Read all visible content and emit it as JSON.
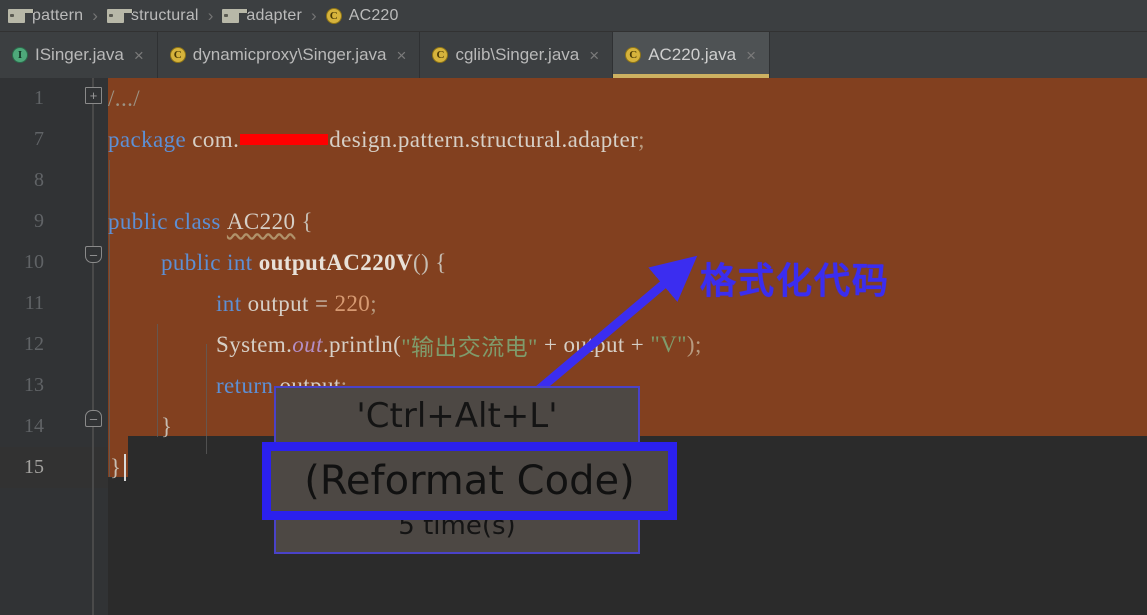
{
  "breadcrumb": {
    "items": [
      {
        "label": "pattern",
        "icon": "folder-icon"
      },
      {
        "label": "structural",
        "icon": "folder-icon"
      },
      {
        "label": "adapter",
        "icon": "folder-icon"
      },
      {
        "label": "AC220",
        "icon": "java-class-icon"
      }
    ],
    "separator": "›"
  },
  "tabs": [
    {
      "label": "ISinger.java",
      "icon": "java-interface-icon",
      "close": "×",
      "active": false
    },
    {
      "label": "dynamicproxy\\Singer.java",
      "icon": "java-class-icon",
      "close": "×",
      "active": false
    },
    {
      "label": "cglib\\Singer.java",
      "icon": "java-class-icon",
      "close": "×",
      "active": false
    },
    {
      "label": "AC220.java",
      "icon": "java-class-icon",
      "close": "×",
      "active": true
    }
  ],
  "editor": {
    "line_numbers": [
      "1",
      "7",
      "8",
      "9",
      "10",
      "11",
      "12",
      "13",
      "14",
      "15"
    ],
    "current_line": "15",
    "fold_markers": {
      "expand": "+",
      "collapse_top": "–",
      "collapse_bottom": "–"
    },
    "lines": {
      "l1_comment": "/.../",
      "l7_package_kw": "package",
      "l7_pkg_a": " com.",
      "l7_pkg_b": "design.pattern.structural.adapter",
      "l7_semi": ";",
      "l9_public": "public",
      "l9_class": "class",
      "l9_name": "AC220",
      "l9_brace": "{",
      "l10_public": "public",
      "l10_int": "int",
      "l10_method": "outputAC220V",
      "l10_parens": "()",
      "l10_brace": "{",
      "l11_int": "int",
      "l11_var": " output = ",
      "l11_num": "220",
      "l11_semi": ";",
      "l12_sysout_a": "System.",
      "l12_out": "out",
      "l12_println": ".println(",
      "l12_str1": "\"输出交流电\"",
      "l12_plus1": " + output + ",
      "l12_str2": "\"V\"",
      "l12_tail": ");",
      "l13_return": "return",
      "l13_var": " output",
      "l13_semi": ";",
      "l14_brace": "}",
      "l15_brace": "}"
    }
  },
  "annotation": {
    "chinese_note": "格式化代码",
    "arrow_color": "#3b2df0"
  },
  "action_hint": {
    "shortcut": "'Ctrl+Alt+L'",
    "action_name": "(Reformat Code)",
    "count": "5 time(s)",
    "highlight_color": "#2b20ee"
  }
}
